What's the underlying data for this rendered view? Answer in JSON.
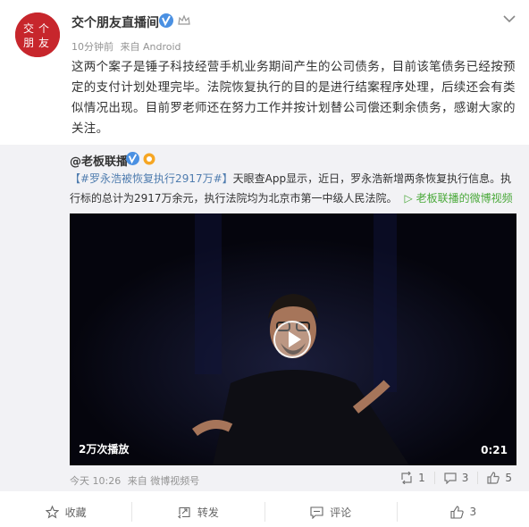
{
  "post": {
    "author": "交个朋友直播间",
    "time": "10分钟前",
    "source": "来自 Android",
    "text": "这两个案子是锤子科技经营手机业务期间产生的公司债务，目前该笔债务已经按预定的支付计划处理完毕。法院恢复执行的目的是进行结案程序处理，后续还会有类似情况出现。目前罗老师还在努力工作并按计划替公司偿还剩余债务，感谢大家的关注。"
  },
  "avatar": {
    "text": "交个朋友",
    "brand_color": "#c7262c"
  },
  "repost": {
    "author": "@老板联播",
    "hashtag": "【#罗永浩被恢复执行2917万#】",
    "body": "天眼查App显示，近日，罗永浩新增两条恢复执行信息。执行标的总计为2917万余元，执行法院均为北京市第一中级人民法院。",
    "video_link": "老板联播的微博视频",
    "video": {
      "play_count": "2万次播放",
      "duration": "0:21"
    },
    "time": "今天 10:26",
    "source": "来自 微博视频号",
    "stats": {
      "reposts": "1",
      "comments": "3",
      "likes": "5"
    }
  },
  "actions": {
    "favorite": "收藏",
    "repost": "转发",
    "comment": "评论",
    "like": "3"
  },
  "colors": {
    "link": "#507daf",
    "video_link": "#4aa93a",
    "verified": "#f6a623",
    "background_repost": "#f2f2f5"
  }
}
